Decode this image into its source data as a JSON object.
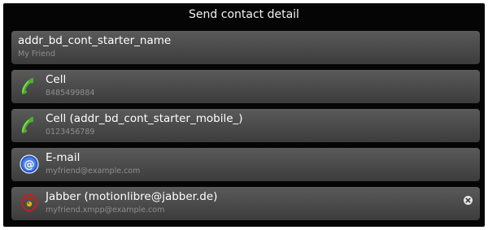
{
  "header": {
    "title": "Send contact detail"
  },
  "rows": [
    {
      "primary": "addr_bd_cont_starter_name",
      "secondary": "My Friend",
      "icon": "none"
    },
    {
      "primary": "Cell",
      "secondary": "8485499884",
      "icon": "phone-icon"
    },
    {
      "primary": "Cell (addr_bd_cont_starter_mobile_)",
      "secondary": "0123456789",
      "icon": "phone-icon"
    },
    {
      "primary": "E-mail",
      "secondary": "myfriend@example.com",
      "icon": "email-at-icon"
    },
    {
      "primary": "Jabber (motionlibre@jabber.de)",
      "secondary": "myfriend.xmpp@example.com",
      "icon": "jabber-icon",
      "trailing_icon": "close-icon"
    }
  ],
  "colors": {
    "background": "#050505",
    "row_top": "#5a5a5a",
    "row_bottom": "#3c3c3c",
    "primary_text": "#ffffff",
    "secondary_text": "#8e8e8e",
    "phone_green": "#4caf2a",
    "email_blue": "#3b6fd8",
    "jabber_red": "#c81e1e"
  }
}
